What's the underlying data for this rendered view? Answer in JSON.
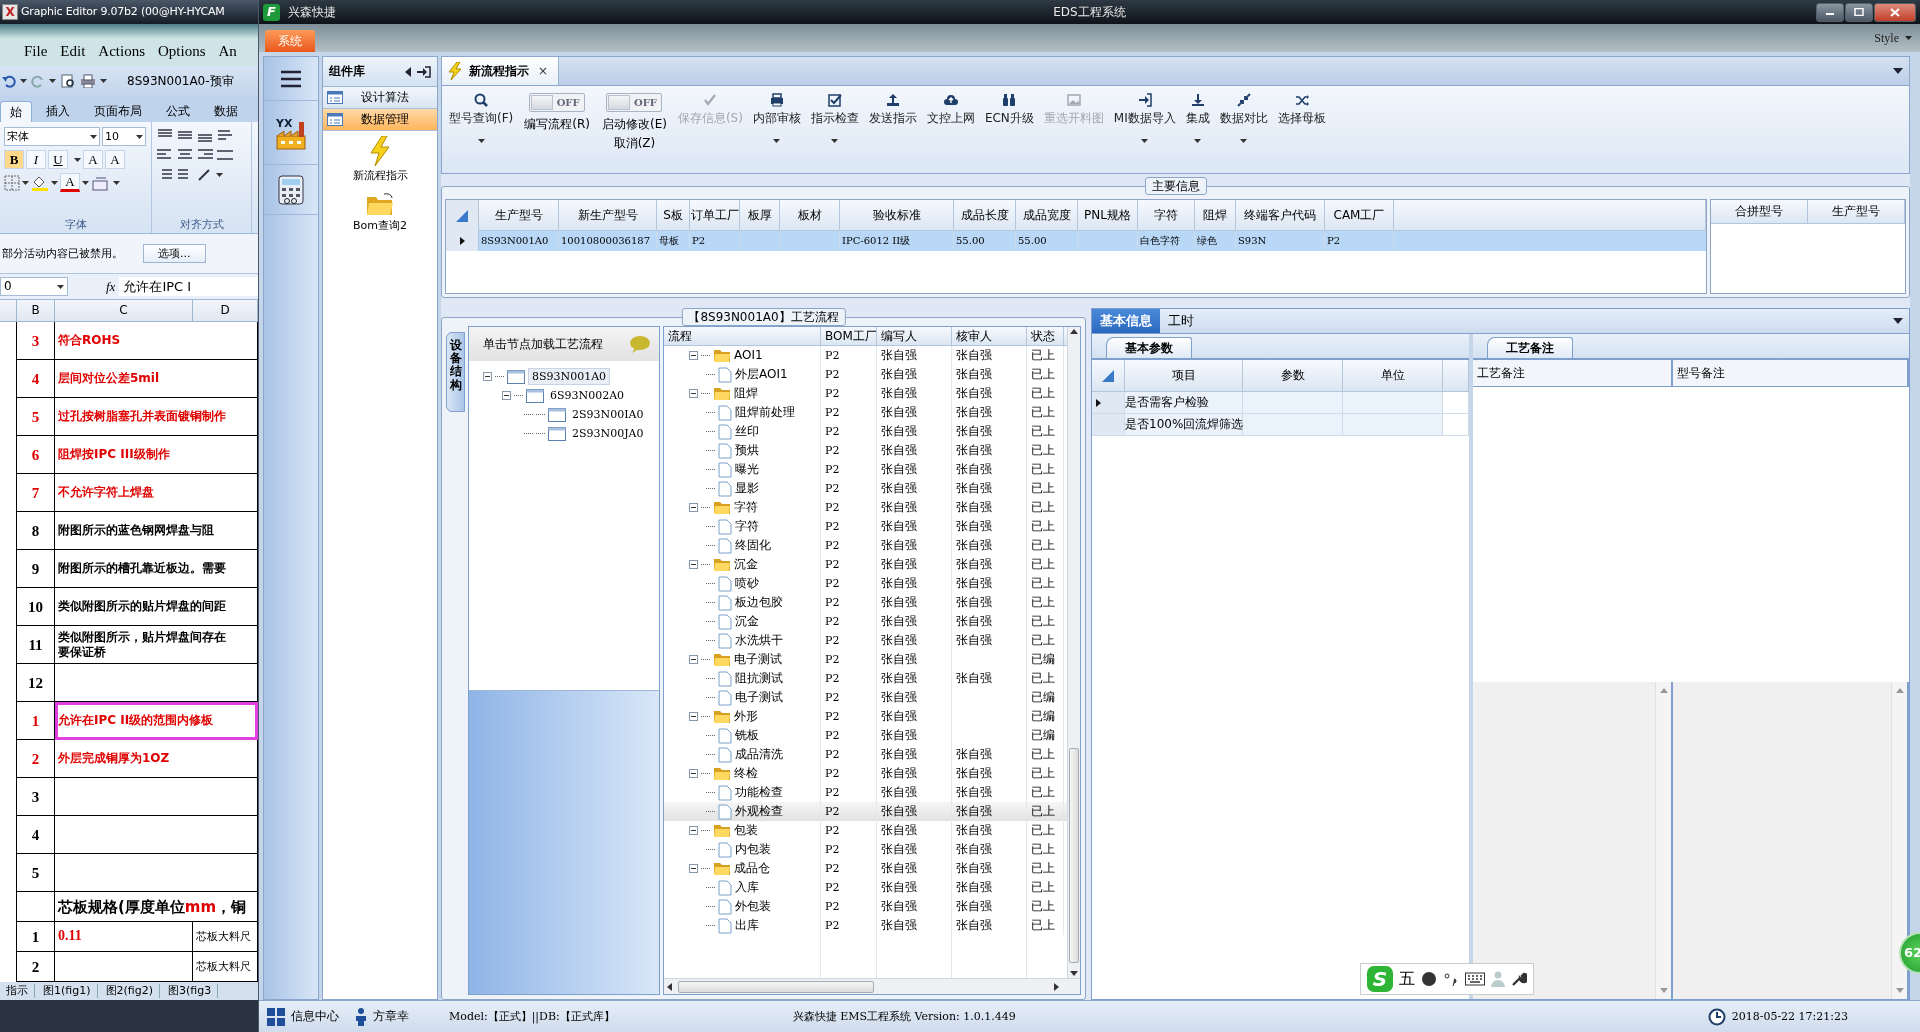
{
  "background_window": {
    "icon_text": "X",
    "title": "Graphic Editor 9.07b2 (00@HY-HYCAM",
    "menu": [
      "File",
      "Edit",
      "Actions",
      "Options",
      "An"
    ]
  },
  "excel": {
    "file_title": "8S93N001A0-预审",
    "ribbon_tabs": [
      {
        "label": "始",
        "selected": true
      },
      {
        "label": "插入",
        "selected": false
      },
      {
        "label": "页面布局",
        "selected": false
      },
      {
        "label": "公式",
        "selected": false
      },
      {
        "label": "数据",
        "selected": false
      }
    ],
    "font_name": "宋体",
    "font_size": "10",
    "font_buttons": [
      "B",
      "I",
      "U",
      "A",
      "A"
    ],
    "font_color_button": "A",
    "group_labels": [
      "字体",
      "对齐方式"
    ],
    "message": "部分活动内容已被禁用。",
    "options_button": "选项...",
    "name_box": "0",
    "fx_label": "fx",
    "formula": "允许在IPC I",
    "columns": [
      "B",
      "C",
      "D"
    ],
    "rows": [
      {
        "kind": "item",
        "number": "3",
        "text": "符合ROHS",
        "red": true,
        "selected": false
      },
      {
        "kind": "item",
        "number": "4",
        "text": "层间对位公差5mil",
        "red": true,
        "selected": false
      },
      {
        "kind": "item",
        "number": "5",
        "text": "过孔按树脂塞孔并表面镀铜制作",
        "red": true,
        "selected": false
      },
      {
        "kind": "item",
        "number": "6",
        "text": "阻焊按IPC III级制作",
        "red": true,
        "selected": false
      },
      {
        "kind": "item",
        "number": "7",
        "text": "不允许字符上焊盘",
        "red": true,
        "selected": false
      },
      {
        "kind": "item",
        "number": "8",
        "text": "附图所示的蓝色钢网焊盘与阻",
        "red": false,
        "selected": false
      },
      {
        "kind": "item",
        "number": "9",
        "text": "附图所示的槽孔靠近板边。需要",
        "red": false,
        "selected": false
      },
      {
        "kind": "item",
        "number": "10",
        "text": "类似附图所示的贴片焊盘的间距",
        "red": false,
        "selected": false
      },
      {
        "kind": "item",
        "number": "11",
        "text": "类似附图所示，贴片焊盘间存在",
        "text_line2": "要保证桥",
        "red": false,
        "selected": false
      },
      {
        "kind": "item",
        "number": "12",
        "red": false,
        "selected": false
      },
      {
        "kind": "item",
        "number": "1",
        "text": "允许在IPC II级的范围内修板",
        "red": true,
        "selected": true
      },
      {
        "kind": "item",
        "number": "2",
        "text": "外层完成铜厚为1OZ",
        "red": true,
        "selected": false
      },
      {
        "kind": "item",
        "number": "3",
        "red": false,
        "selected": false
      },
      {
        "kind": "item",
        "number": "4",
        "red": false,
        "selected": false
      },
      {
        "kind": "item",
        "number": "5",
        "red": false,
        "selected": false
      },
      {
        "kind": "section",
        "text": "芯板规格(厚度单位",
        "red_part": "mm",
        "tail": "，铜"
      },
      {
        "kind": "spec",
        "number": "1",
        "text": "0.11",
        "d_text": "芯板大料尺"
      },
      {
        "kind": "spec",
        "number": "2",
        "d_text": "芯板大料尺"
      }
    ],
    "sheet_tabs": [
      "指示",
      "图1(fig1)",
      "图2(fig2)",
      "图3(fig3"
    ]
  },
  "app": {
    "logo": "F",
    "title": "兴森快捷",
    "center_title": "EDS工程系统",
    "system_tab": "系统",
    "style_menu": "Style",
    "sidebar_logo": "YX"
  },
  "component_panel": {
    "title": "组件库",
    "categories": [
      {
        "label": "设计算法",
        "selected": false
      },
      {
        "label": "数据管理",
        "selected": true
      }
    ],
    "items": [
      {
        "label": "新流程指示"
      },
      {
        "label": "Bom查询2"
      }
    ]
  },
  "document_tab": {
    "label": "新流程指示",
    "close": "×"
  },
  "toolbar": [
    {
      "kind": "button",
      "label": "型号查询(F)",
      "disabled": false,
      "dropdown": true
    },
    {
      "kind": "toggle",
      "label": "编写流程(R)",
      "switch_text": "OFF",
      "on": false
    },
    {
      "kind": "toggle",
      "label": "启动修改(E)",
      "label2": "取消(Z)",
      "switch_text": "OFF",
      "on": false
    },
    {
      "kind": "button",
      "label": "保存信息(S)",
      "disabled": true,
      "dropdown": false
    },
    {
      "kind": "button",
      "label": "内部审核",
      "disabled": false,
      "dropdown": true
    },
    {
      "kind": "button",
      "label": "指示检查",
      "disabled": false,
      "dropdown": true
    },
    {
      "kind": "button",
      "label": "发送指示",
      "disabled": false,
      "dropdown": false
    },
    {
      "kind": "button",
      "label": "文控上网",
      "disabled": false,
      "dropdown": false
    },
    {
      "kind": "button",
      "label": "ECN升级",
      "disabled": false,
      "dropdown": false
    },
    {
      "kind": "button",
      "label": "重选开料图",
      "disabled": true,
      "dropdown": false
    },
    {
      "kind": "button",
      "label": "MI数据导入",
      "disabled": false,
      "dropdown": true
    },
    {
      "kind": "button",
      "label": "集成",
      "disabled": false,
      "dropdown": true
    },
    {
      "kind": "button",
      "label": "数据对比",
      "disabled": false,
      "dropdown": true
    },
    {
      "kind": "button",
      "label": "选择母板",
      "disabled": false,
      "dropdown": false
    }
  ],
  "main_info": {
    "title": "主要信息",
    "columns": [
      "生产型号",
      "新生产型号",
      "S板",
      "订单工厂",
      "板厚",
      "板材",
      "验收标准",
      "成品长度",
      "成品宽度",
      "PNL规格",
      "字符",
      "阻焊",
      "终端客户代码",
      "CAM工厂"
    ],
    "rows": [
      {
        "selected": true,
        "cells": [
          "8S93N001A0",
          "10010800036187",
          "母板",
          "P2",
          null,
          null,
          "IPC-6012 II级",
          "55.00",
          "55.00",
          null,
          "白色字符",
          "绿色",
          "S93N",
          "P2"
        ]
      }
    ],
    "merge_columns": [
      "合拼型号",
      "生产型号"
    ]
  },
  "process": {
    "title": "【8S93N001A0】工艺流程",
    "side_tab": "设备结构",
    "hint": "单击节点加载工艺流程",
    "structure_tree": [
      {
        "label": "8S93N001A0",
        "selected": true,
        "expanded": true,
        "children": [
          {
            "label": "6S93N002A0",
            "selected": false,
            "expanded": true,
            "children": [
              {
                "label": "2S93N00IA0",
                "selected": false
              },
              {
                "label": "2S93N00JA0",
                "selected": false
              }
            ]
          }
        ]
      }
    ],
    "columns": [
      "流程",
      "BOM工厂",
      "编写人",
      "核审人",
      "状态"
    ],
    "steps": [
      {
        "name": "AOI1",
        "factory": "P2",
        "writer": "张自强",
        "reviewer": "张自强",
        "status": "已上",
        "selected": false,
        "expanded": true,
        "children": [
          {
            "name": "外层AOI1",
            "factory": "P2",
            "writer": "张自强",
            "reviewer": "张自强",
            "status": "已上",
            "selected": false
          }
        ]
      },
      {
        "name": "阻焊",
        "factory": "P2",
        "writer": "张自强",
        "reviewer": "张自强",
        "status": "已上",
        "selected": false,
        "expanded": true,
        "children": [
          {
            "name": "阻焊前处理",
            "factory": "P2",
            "writer": "张自强",
            "reviewer": "张自强",
            "status": "已上",
            "selected": false
          },
          {
            "name": "丝印",
            "factory": "P2",
            "writer": "张自强",
            "reviewer": "张自强",
            "status": "已上",
            "selected": false
          },
          {
            "name": "预烘",
            "factory": "P2",
            "writer": "张自强",
            "reviewer": "张自强",
            "status": "已上",
            "selected": false
          },
          {
            "name": "曝光",
            "factory": "P2",
            "writer": "张自强",
            "reviewer": "张自强",
            "status": "已上",
            "selected": false
          },
          {
            "name": "显影",
            "factory": "P2",
            "writer": "张自强",
            "reviewer": "张自强",
            "status": "已上",
            "selected": false
          }
        ]
      },
      {
        "name": "字符",
        "factory": "P2",
        "writer": "张自强",
        "reviewer": "张自强",
        "status": "已上",
        "selected": false,
        "expanded": true,
        "children": [
          {
            "name": "字符",
            "factory": "P2",
            "writer": "张自强",
            "reviewer": "张自强",
            "status": "已上",
            "selected": false
          },
          {
            "name": "终固化",
            "factory": "P2",
            "writer": "张自强",
            "reviewer": "张自强",
            "status": "已上",
            "selected": false
          }
        ]
      },
      {
        "name": "沉金",
        "factory": "P2",
        "writer": "张自强",
        "reviewer": "张自强",
        "status": "已上",
        "selected": false,
        "expanded": true,
        "children": [
          {
            "name": "喷砂",
            "factory": "P2",
            "writer": "张自强",
            "reviewer": "张自强",
            "status": "已上",
            "selected": false
          },
          {
            "name": "板边包胶",
            "factory": "P2",
            "writer": "张自强",
            "reviewer": "张自强",
            "status": "已上",
            "selected": false
          },
          {
            "name": "沉金",
            "factory": "P2",
            "writer": "张自强",
            "reviewer": "张自强",
            "status": "已上",
            "selected": false
          },
          {
            "name": "水洗烘干",
            "factory": "P2",
            "writer": "张自强",
            "reviewer": "张自强",
            "status": "已上",
            "selected": false
          }
        ]
      },
      {
        "name": "电子测试",
        "factory": "P2",
        "writer": "张自强",
        "status": "已编",
        "selected": false,
        "expanded": true,
        "children": [
          {
            "name": "阻抗测试",
            "factory": "P2",
            "writer": "张自强",
            "reviewer": "张自强",
            "status": "已上",
            "selected": false
          },
          {
            "name": "电子测试",
            "factory": "P2",
            "writer": "张自强",
            "status": "已编",
            "selected": false
          }
        ]
      },
      {
        "name": "外形",
        "factory": "P2",
        "writer": "张自强",
        "status": "已编",
        "selected": false,
        "expanded": true,
        "children": [
          {
            "name": "铣板",
            "factory": "P2",
            "writer": "张自强",
            "status": "已编",
            "selected": false
          },
          {
            "name": "成品清洗",
            "factory": "P2",
            "writer": "张自强",
            "reviewer": "张自强",
            "status": "已上",
            "selected": false
          }
        ]
      },
      {
        "name": "终检",
        "factory": "P2",
        "writer": "张自强",
        "reviewer": "张自强",
        "status": "已上",
        "selected": false,
        "expanded": true,
        "children": [
          {
            "name": "功能检查",
            "factory": "P2",
            "writer": "张自强",
            "reviewer": "张自强",
            "status": "已上",
            "selected": false
          },
          {
            "name": "外观检查",
            "factory": "P2",
            "writer": "张自强",
            "reviewer": "张自强",
            "status": "已上",
            "selected": true
          }
        ]
      },
      {
        "name": "包装",
        "factory": "P2",
        "writer": "张自强",
        "reviewer": "张自强",
        "status": "已上",
        "selected": false,
        "expanded": true,
        "children": [
          {
            "name": "内包装",
            "factory": "P2",
            "writer": "张自强",
            "reviewer": "张自强",
            "status": "已上",
            "selected": false
          }
        ]
      },
      {
        "name": "成品仓",
        "factory": "P2",
        "writer": "张自强",
        "reviewer": "张自强",
        "status": "已上",
        "selected": false,
        "expanded": true,
        "children": [
          {
            "name": "入库",
            "factory": "P2",
            "writer": "张自强",
            "reviewer": "张自强",
            "status": "已上",
            "selected": false
          },
          {
            "name": "外包装",
            "factory": "P2",
            "writer": "张自强",
            "reviewer": "张自强",
            "status": "已上",
            "selected": false
          },
          {
            "name": "出库",
            "factory": "P2",
            "writer": "张自强",
            "reviewer": "张自强",
            "status": "已上",
            "selected": false
          }
        ]
      }
    ]
  },
  "detail": {
    "tabs": [
      {
        "label": "基本信息",
        "selected": true
      },
      {
        "label": "工时",
        "selected": false
      }
    ],
    "params_tab": "基本参数",
    "param_columns": [
      "项目",
      "参数",
      "单位"
    ],
    "params": [
      {
        "item": "是否需客户检验",
        "current": true
      },
      {
        "item": "是否100%回流焊筛选",
        "current": false
      }
    ],
    "notes_tab": "工艺备注",
    "note_columns": [
      "工艺备注",
      "型号备注"
    ]
  },
  "ime_toolbar": {
    "logo": "S",
    "mode": "五"
  },
  "floating_badge": "62",
  "status_bar": {
    "info_center": "信息中心",
    "user": "方章幸",
    "model": "Model:【正式】||DB:【正式库】",
    "version": "兴森快捷 EMS工程系统 Version: 1.0.1.449",
    "datetime": "2018-05-22 17:21:23"
  }
}
